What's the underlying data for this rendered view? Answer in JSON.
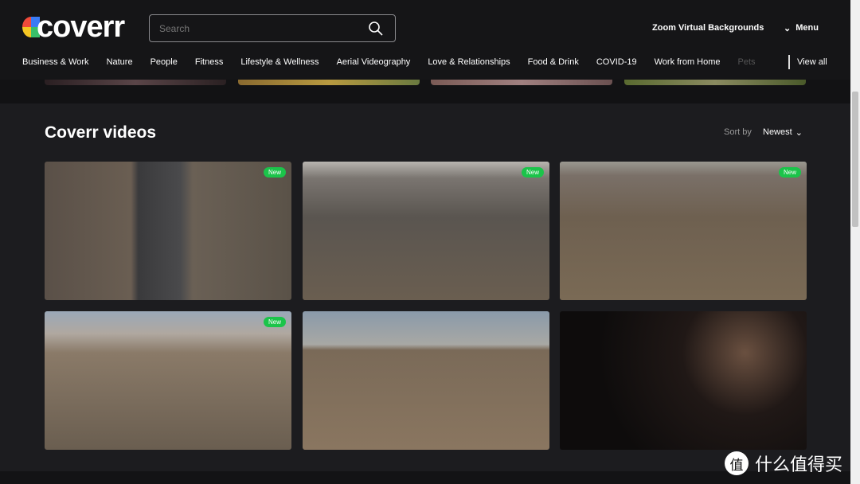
{
  "header": {
    "logo": "coverr",
    "search_placeholder": "Search",
    "zoom_link": "Zoom Virtual Backgrounds",
    "menu": "Menu"
  },
  "categories": [
    "Business & Work",
    "Nature",
    "People",
    "Fitness",
    "Lifestyle & Wellness",
    "Aerial Videography",
    "Love & Relationships",
    "Food & Drink",
    "COVID-19",
    "Work from Home",
    "Pets"
  ],
  "view_all": "View all",
  "section": {
    "title": "Coverr videos",
    "sort_label": "Sort by",
    "sort_value": "Newest"
  },
  "videos": [
    {
      "badge": "New"
    },
    {
      "badge": "New"
    },
    {
      "badge": "New"
    },
    {
      "badge": "New"
    },
    {
      "badge": null
    },
    {
      "badge": null
    }
  ],
  "colors": {
    "badge": "#1bc44a",
    "header": "#151517",
    "background": "#1c1c1f"
  },
  "watermark": "什么值得买"
}
